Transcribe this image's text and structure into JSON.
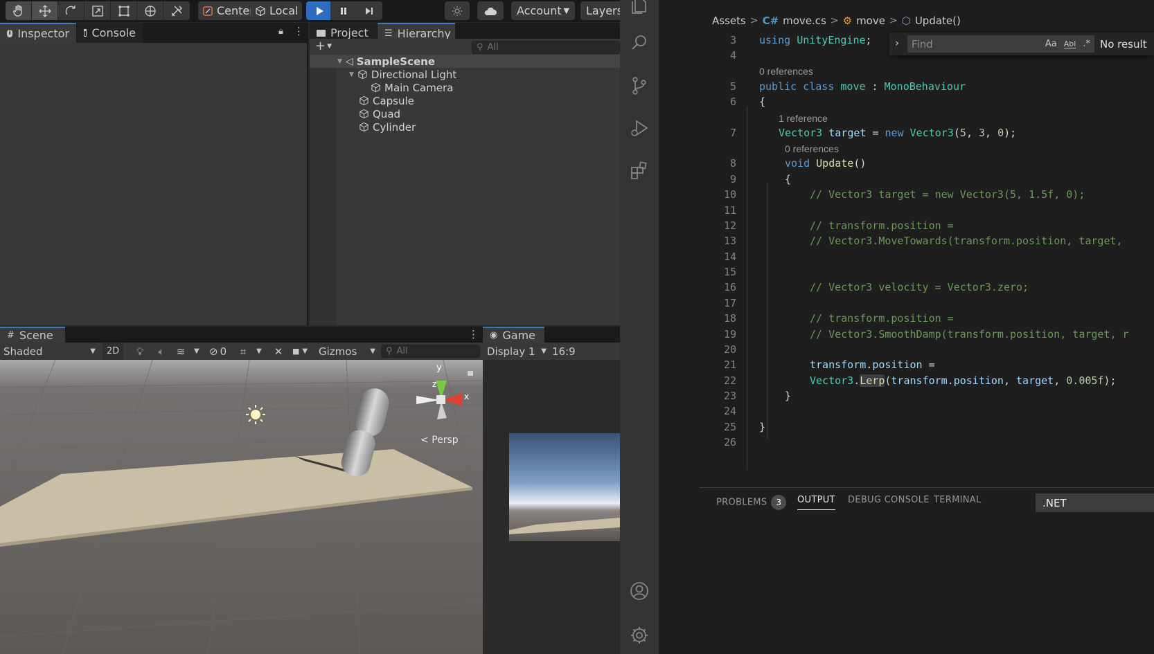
{
  "unity": {
    "toolbar": {
      "pivot_center": "Center",
      "pivot_local": "Local",
      "account": "Account",
      "layers": "Layers"
    },
    "inspector_tabs": [
      "Inspector",
      "Console"
    ],
    "project_tabs": [
      "Project",
      "Hierarchy"
    ],
    "hierarchy_search_placeholder": "All",
    "hierarchy": {
      "scene": "SampleScene",
      "items": [
        "Directional Light",
        "Main Camera",
        "Capsule",
        "Quad",
        "Cylinder"
      ]
    },
    "scene_tab": "Scene",
    "scene_toolbar": {
      "shading": "Shaded",
      "mode_2d": "2D",
      "hidden_count": "0",
      "gizmos": "Gizmos",
      "search_placeholder": "All",
      "persp": "Persp",
      "axis_x": "x",
      "axis_y": "y",
      "axis_z": "z"
    },
    "game_tab": "Game",
    "game_toolbar": {
      "display": "Display 1",
      "aspect": "16:9"
    }
  },
  "vscode": {
    "breadcrumbs": [
      "Assets",
      "move.cs",
      "move",
      "Update()"
    ],
    "find": {
      "placeholder": "Find",
      "case_label": "Aa",
      "word_label": "Abl",
      "regex_label": ".*",
      "result": "No result"
    },
    "code_lines": [
      {
        "n": "3",
        "text": "using UnityEngine;"
      },
      {
        "n": "4",
        "text": ""
      },
      {
        "n": "5",
        "text": "public class move : MonoBehaviour"
      },
      {
        "n": "6",
        "text": "{"
      },
      {
        "n": "7",
        "text": "Vector3 target = new Vector3(5, 3, 0);"
      },
      {
        "n": "8",
        "text": "void Update()"
      },
      {
        "n": "9",
        "text": "{"
      },
      {
        "n": "10",
        "text": "// Vector3 target = new Vector3(5, 1.5f, 0);"
      },
      {
        "n": "11",
        "text": ""
      },
      {
        "n": "12",
        "text": "// transform.position ="
      },
      {
        "n": "13",
        "text": "// Vector3.MoveTowards(transform.position, target, "
      },
      {
        "n": "14",
        "text": ""
      },
      {
        "n": "15",
        "text": ""
      },
      {
        "n": "16",
        "text": "// Vector3 velocity = Vector3.zero;"
      },
      {
        "n": "17",
        "text": ""
      },
      {
        "n": "18",
        "text": "// transform.position ="
      },
      {
        "n": "19",
        "text": "// Vector3.SmoothDamp(transform.position, target, r"
      },
      {
        "n": "20",
        "text": ""
      },
      {
        "n": "21",
        "text": "transform.position ="
      },
      {
        "n": "22",
        "text": "Vector3.Lerp(transform.position, target, 0.005f);"
      },
      {
        "n": "23",
        "text": "}"
      },
      {
        "n": "24",
        "text": ""
      },
      {
        "n": "25",
        "text": "}"
      },
      {
        "n": "26",
        "text": ""
      }
    ],
    "codelens": {
      "class_refs": "0 references",
      "target_refs": "1 reference",
      "update_refs": "0 references"
    },
    "panel": {
      "tabs": [
        "PROBLEMS",
        "OUTPUT",
        "DEBUG CONSOLE",
        "TERMINAL"
      ],
      "problems_count": "3",
      "output_channel": ".NET"
    }
  }
}
